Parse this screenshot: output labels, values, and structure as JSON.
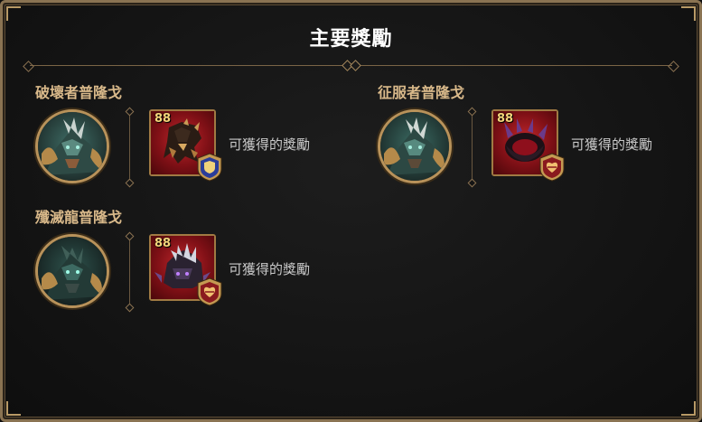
{
  "panel": {
    "title": "主要獎勵"
  },
  "groups": [
    {
      "name": "破壞者普隆戈",
      "item_level": "88",
      "reward_text": "可獲得的獎勵",
      "badge_icon": "shield-badge-icon",
      "portrait_icon": "dragon-portrait-icon",
      "item_icon": "armor-item-icon"
    },
    {
      "name": "征服者普隆戈",
      "item_level": "88",
      "reward_text": "可獲得的獎勵",
      "badge_icon": "heart-badge-icon",
      "portrait_icon": "dragon-portrait-icon",
      "item_icon": "claw-ring-item-icon"
    },
    {
      "name": "殲滅龍普隆戈",
      "item_level": "88",
      "reward_text": "可獲得的獎勵",
      "badge_icon": "heart-badge-icon",
      "portrait_icon": "dragon-portrait-icon",
      "item_icon": "dragon-helm-item-icon"
    }
  ],
  "colors": {
    "frame_border": "#8a7352",
    "group_name": "#d9b98a",
    "item_bg": "#c0272b",
    "level_text": "#f4d57a"
  }
}
